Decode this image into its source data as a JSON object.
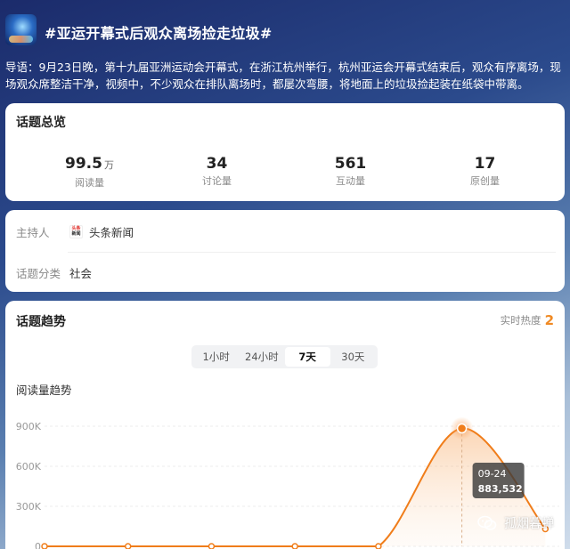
{
  "topic": {
    "title": "#亚运开幕式后观众离场捡走垃圾#",
    "guide": "导语：9月23日晚，第十九届亚洲运动会开幕式，在浙江杭州举行，杭州亚运会开幕式结束后，观众有序离场，现场观众席整洁干净，视频中，不少观众在排队离场时，都屡次弯腰，将地面上的垃圾捡起装在纸袋中带离。"
  },
  "overview": {
    "title": "话题总览",
    "stats": [
      {
        "value": "99.5",
        "unit": "万",
        "label": "阅读量"
      },
      {
        "value": "34",
        "unit": "",
        "label": "讨论量"
      },
      {
        "value": "561",
        "unit": "",
        "label": "互动量"
      },
      {
        "value": "17",
        "unit": "",
        "label": "原创量"
      }
    ]
  },
  "info": {
    "host_label": "主持人",
    "host_logo_text": [
      "头条",
      "新闻"
    ],
    "host_value": "头条新闻",
    "category_label": "话题分类",
    "category_value": "社会"
  },
  "trend": {
    "title": "话题趋势",
    "hot_label": "实时热度",
    "hot_value": "2",
    "tabs": [
      {
        "label": "1小时",
        "active": false
      },
      {
        "label": "24小时",
        "active": false
      },
      {
        "label": "7天",
        "active": true
      },
      {
        "label": "30天",
        "active": false
      }
    ],
    "chart_title": "阅读量趋势",
    "accent_color": "#f07d1a"
  },
  "chart_data": {
    "type": "area",
    "title": "阅读量趋势",
    "yticks": [
      "900K",
      "600K",
      "300K",
      "0"
    ],
    "ylim": [
      0,
      900000
    ],
    "points": [
      {
        "value": 0
      },
      {
        "value": 0
      },
      {
        "value": 0
      },
      {
        "value": 0
      },
      {
        "value": 0
      },
      {
        "value": 883532,
        "label": "09-24"
      },
      {
        "value": 130000
      }
    ],
    "tooltip": {
      "date": "09-24",
      "value": "883,532"
    }
  },
  "watermark": {
    "text": "孤烟暮蝉",
    "icon": "wechat-icon"
  }
}
